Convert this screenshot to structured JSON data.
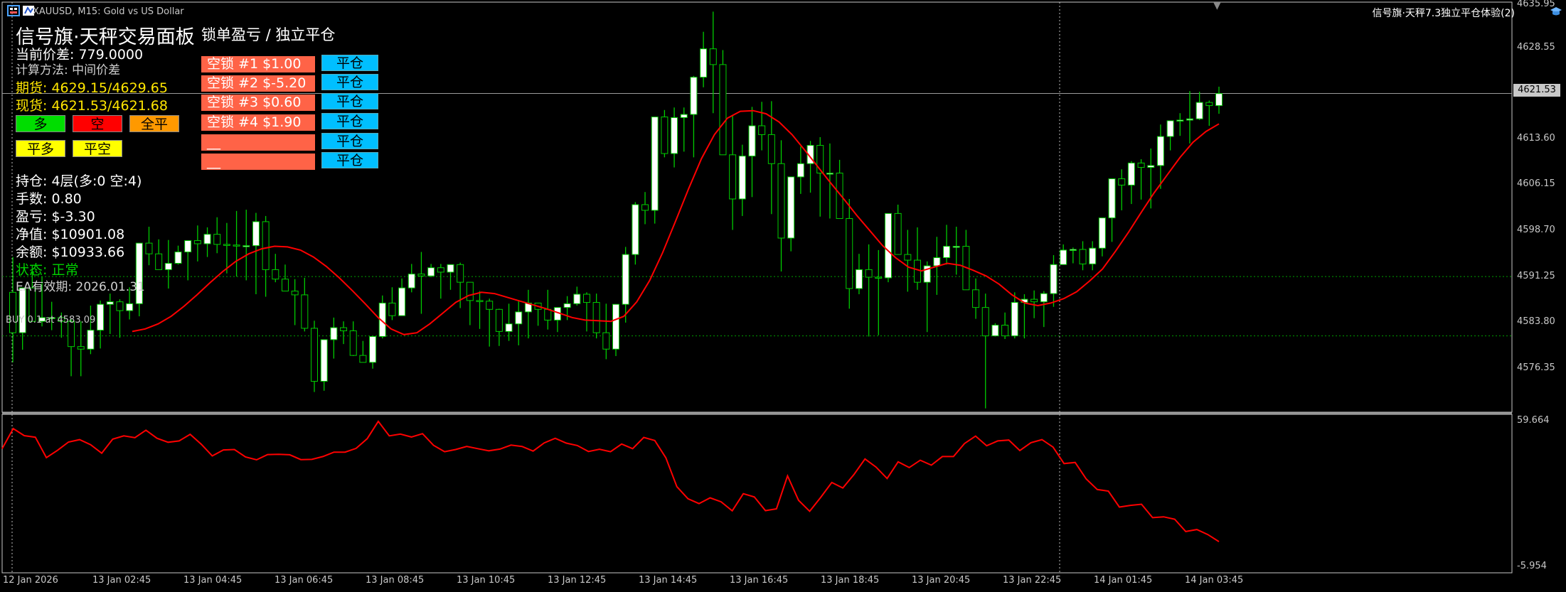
{
  "window": {
    "symbol_title": "XAUUSD, M15:  Gold vs US Dollar",
    "indicator_name": "信号旗·天秤7.3独立平仓体验(2)",
    "icons": [
      "chart-menu-icon",
      "chart-type-icon",
      "hat-icon"
    ]
  },
  "panel": {
    "title": "信号旗·天秤交易面板",
    "current_spread": "当前价差: 779.0000",
    "calc_method": "计算方法: 中间价差",
    "futures": "期货: 4629.15/4629.65",
    "spot": "现货: 4621.53/4621.68",
    "buttons": {
      "buy": "多",
      "sell": "空",
      "close_all": "全平",
      "close_buy": "平多",
      "close_sell": "平空"
    },
    "holdings": "持仓: 4层(多:0 空:4)",
    "lots": "手数: 0.80",
    "profit": "盈亏: $-3.30",
    "equity": "净值: $10901.08",
    "balance": "余额: $10933.66",
    "status": "状态: 正常",
    "expiry": "EA有效期: 2026.01.31"
  },
  "lock_panel": {
    "title": "锁单盈亏 / 独立平仓",
    "rows": [
      {
        "label": "空锁 #1  $1.00",
        "button": "平仓"
      },
      {
        "label": "空锁 #2  $-5.20",
        "button": "平仓"
      },
      {
        "label": "空锁 #3  $0.60",
        "button": "平仓"
      },
      {
        "label": "空锁 #4  $1.90",
        "button": "平仓"
      },
      {
        "label": "__",
        "button": "平仓"
      },
      {
        "label": "__",
        "button": "平仓"
      }
    ]
  },
  "order_label": "BUY 0.1 at 4583.09",
  "price_axis": [
    "4635.95",
    "4628.55",
    "4621.53",
    "4613.60",
    "4606.15",
    "4598.70",
    "4591.25",
    "4583.80",
    "4576.35"
  ],
  "current_price": "4621.53",
  "indicator_axis": [
    "59.664",
    "-5.954"
  ],
  "time_axis": [
    "12 Jan 2026",
    "13 Jan 02:45",
    "13 Jan 04:45",
    "13 Jan 06:45",
    "13 Jan 08:45",
    "13 Jan 10:45",
    "13 Jan 12:45",
    "13 Jan 14:45",
    "13 Jan 16:45",
    "13 Jan 18:45",
    "13 Jan 20:45",
    "13 Jan 22:45",
    "14 Jan 01:45",
    "14 Jan 03:45"
  ],
  "colors": {
    "bull": "#ffffff",
    "bear": "#000000",
    "wick": "#00cc00",
    "ma": "#ff0000",
    "grid_dotted": "#00a000",
    "border": "#c8c8c8"
  },
  "chart_data": {
    "type": "candlestick",
    "price_range": [
      4571.0,
      4636.0
    ],
    "indicator_range": [
      -5.954,
      59.664
    ],
    "candles_ohlc": [
      [
        4590.0,
        4595.6,
        4578.9,
        4583.6
      ],
      [
        4583.6,
        4590.7,
        4580.9,
        4590.7
      ],
      [
        4590.7,
        4594.3,
        4585.4,
        4585.4
      ],
      [
        4585.4,
        4592.5,
        4584.6,
        4586.0
      ],
      [
        4586.0,
        4588.5,
        4584.0,
        4586.0
      ],
      [
        4586.0,
        4586.8,
        4582.8,
        4585.4
      ],
      [
        4585.4,
        4585.8,
        4576.7,
        4581.4
      ],
      [
        4581.4,
        4585.4,
        4576.7,
        4581.0
      ],
      [
        4581.0,
        4587.9,
        4580.2,
        4584.0
      ],
      [
        4584.0,
        4588.7,
        4581.1,
        4588.1
      ],
      [
        4588.1,
        4589.8,
        4583.4,
        4588.5
      ],
      [
        4588.5,
        4588.9,
        4582.8,
        4587.1
      ],
      [
        4587.1,
        4590.8,
        4585.7,
        4588.2
      ],
      [
        4588.2,
        4597.8,
        4586.2,
        4597.8
      ],
      [
        4597.8,
        4600.4,
        4594.3,
        4596.1
      ],
      [
        4596.1,
        4598.4,
        4593.8,
        4593.6
      ],
      [
        4593.6,
        4598.3,
        4590.6,
        4594.6
      ],
      [
        4594.6,
        4597.4,
        4594.4,
        4596.4
      ],
      [
        4596.4,
        4598.2,
        4591.9,
        4598.2
      ],
      [
        4598.2,
        4600.6,
        4594.9,
        4597.7
      ],
      [
        4597.7,
        4600.3,
        4595.6,
        4599.2
      ],
      [
        4599.2,
        4601.9,
        4596.2,
        4597.6
      ],
      [
        4597.6,
        4601.0,
        4593.0,
        4597.5
      ],
      [
        4597.5,
        4602.9,
        4592.5,
        4597.4
      ],
      [
        4597.4,
        4603.1,
        4591.9,
        4597.4
      ],
      [
        4597.4,
        4602.6,
        4589.7,
        4601.2
      ],
      [
        4601.2,
        4602.1,
        4589.3,
        4593.6
      ],
      [
        4593.6,
        4596.1,
        4591.6,
        4592.1
      ],
      [
        4592.1,
        4594.4,
        4590.5,
        4590.2
      ],
      [
        4590.2,
        4592.1,
        4584.8,
        4589.6
      ],
      [
        4589.6,
        4592.3,
        4583.8,
        4584.3
      ],
      [
        4584.3,
        4585.5,
        4574.2,
        4575.9
      ],
      [
        4575.9,
        4579.3,
        4574.4,
        4582.5
      ],
      [
        4582.5,
        4586.0,
        4579.5,
        4584.4
      ],
      [
        4584.4,
        4585.4,
        4581.8,
        4583.9
      ],
      [
        4583.9,
        4585.4,
        4579.9,
        4580.0
      ],
      [
        4580.0,
        4582.3,
        4579.5,
        4578.9
      ],
      [
        4578.9,
        4581.6,
        4577.9,
        4583.0
      ],
      [
        4583.0,
        4589.5,
        4582.7,
        4588.3
      ],
      [
        4588.3,
        4590.8,
        4585.6,
        4586.3
      ],
      [
        4586.3,
        4592.2,
        4586.4,
        4590.7
      ],
      [
        4590.7,
        4594.5,
        4590.0,
        4592.9
      ],
      [
        4592.9,
        4596.4,
        4586.6,
        4592.6
      ],
      [
        4592.6,
        4594.5,
        4592.4,
        4593.9
      ],
      [
        4593.9,
        4594.5,
        4589.0,
        4593.2
      ],
      [
        4593.2,
        4594.4,
        4590.4,
        4594.4
      ],
      [
        4594.4,
        4594.7,
        4587.5,
        4591.6
      ],
      [
        4591.6,
        4591.1,
        4584.8,
        4588.7
      ],
      [
        4588.7,
        4590.2,
        4584.2,
        4588.6
      ],
      [
        4588.6,
        4589.0,
        4581.4,
        4587.3
      ],
      [
        4587.3,
        4587.4,
        4581.5,
        4583.8
      ],
      [
        4583.8,
        4588.2,
        4582.3,
        4585.0
      ],
      [
        4585.0,
        4588.7,
        4581.6,
        4586.9
      ],
      [
        4586.9,
        4590.4,
        4582.7,
        4588.3
      ],
      [
        4588.3,
        4588.2,
        4584.7,
        4587.3
      ],
      [
        4587.3,
        4590.4,
        4584.1,
        4585.6
      ],
      [
        4585.6,
        4587.6,
        4583.7,
        4587.6
      ],
      [
        4587.6,
        4589.4,
        4585.6,
        4588.2
      ],
      [
        4588.2,
        4590.9,
        4587.9,
        4589.7
      ],
      [
        4589.7,
        4590.0,
        4583.8,
        4588.4
      ],
      [
        4588.4,
        4589.8,
        4582.7,
        4583.6
      ],
      [
        4583.6,
        4588.2,
        4579.4,
        4581.0
      ],
      [
        4581.0,
        4588.1,
        4579.9,
        4588.1
      ],
      [
        4588.1,
        4597.2,
        4585.2,
        4596.0
      ],
      [
        4596.0,
        4604.3,
        4594.4,
        4603.9
      ],
      [
        4603.9,
        4605.9,
        4600.8,
        4603.0
      ],
      [
        4603.0,
        4616.8,
        4600.9,
        4617.8
      ],
      [
        4617.8,
        4618.9,
        4611.4,
        4612.0
      ],
      [
        4612.0,
        4619.3,
        4609.8,
        4617.7
      ],
      [
        4617.7,
        4619.3,
        4612.3,
        4618.2
      ],
      [
        4618.2,
        4624.3,
        4611.4,
        4624.1
      ],
      [
        4624.1,
        4631.3,
        4622.5,
        4628.6
      ],
      [
        4628.6,
        4634.5,
        4618.4,
        4626.1
      ],
      [
        4626.1,
        4628.4,
        4615.8,
        4611.8
      ],
      [
        4611.8,
        4618.1,
        4599.9,
        4604.8
      ],
      [
        4604.8,
        4613.4,
        4602.1,
        4611.6
      ],
      [
        4611.6,
        4619.4,
        4605.1,
        4616.4
      ],
      [
        4616.4,
        4620.2,
        4612.5,
        4615.0
      ],
      [
        4615.0,
        4620.3,
        4602.4,
        4610.4
      ],
      [
        4610.4,
        4614.1,
        4593.3,
        4598.6
      ],
      [
        4598.6,
        4604.6,
        4596.5,
        4608.3
      ],
      [
        4608.3,
        4613.1,
        4605.6,
        4610.4
      ],
      [
        4610.4,
        4614.0,
        4605.8,
        4613.3
      ],
      [
        4613.3,
        4614.6,
        4602.0,
        4608.9
      ],
      [
        4608.9,
        4613.6,
        4601.7,
        4608.9
      ],
      [
        4608.9,
        4611.0,
        4604.8,
        4601.7
      ],
      [
        4601.7,
        4604.8,
        4587.4,
        4590.6
      ],
      [
        4590.6,
        4596.1,
        4589.7,
        4593.6
      ],
      [
        4593.6,
        4597.6,
        4583.0,
        4592.4
      ],
      [
        4592.4,
        4596.7,
        4583.2,
        4592.3
      ],
      [
        4592.3,
        4595.7,
        4591.6,
        4602.5
      ],
      [
        4602.5,
        4603.9,
        4599.5,
        4596.0
      ],
      [
        4596.0,
        4599.9,
        4590.1,
        4595.1
      ],
      [
        4595.1,
        4600.3,
        4590.4,
        4591.6
      ],
      [
        4591.6,
        4594.9,
        4583.7,
        4594.2
      ],
      [
        4594.2,
        4598.8,
        4589.6,
        4595.5
      ],
      [
        4595.5,
        4600.7,
        4594.4,
        4597.3
      ],
      [
        4597.3,
        4600.4,
        4592.8,
        4597.3
      ],
      [
        4597.3,
        4599.9,
        4591.4,
        4590.4
      ],
      [
        4590.4,
        4592.2,
        4585.8,
        4587.6
      ],
      [
        4587.6,
        4589.8,
        4571.6,
        4583.1
      ],
      [
        4583.1,
        4585.1,
        4583.0,
        4584.8
      ],
      [
        4584.8,
        4586.8,
        4582.6,
        4583.1
      ],
      [
        4583.1,
        4590.0,
        4582.7,
        4588.4
      ],
      [
        4588.4,
        4589.7,
        4582.7,
        4588.9
      ],
      [
        4588.9,
        4590.3,
        4585.9,
        4588.5
      ],
      [
        4588.5,
        4590.2,
        4584.5,
        4589.8
      ],
      [
        4589.8,
        4595.9,
        4587.7,
        4594.4
      ],
      [
        4594.4,
        4597.6,
        4594.4,
        4596.7
      ],
      [
        4596.7,
        4597.1,
        4594.6,
        4596.8
      ],
      [
        4596.8,
        4598.1,
        4593.5,
        4594.5
      ],
      [
        4594.5,
        4598.1,
        4593.5,
        4597.0
      ],
      [
        4597.0,
        4601.8,
        4595.7,
        4601.8
      ],
      [
        4601.8,
        4607.1,
        4598.0,
        4608.0
      ],
      [
        4608.0,
        4609.5,
        4603.0,
        4607.0
      ],
      [
        4607.0,
        4610.8,
        4604.0,
        4610.5
      ],
      [
        4610.5,
        4611.1,
        4604.7,
        4609.8
      ],
      [
        4609.8,
        4612.8,
        4603.3,
        4610.1
      ],
      [
        4610.1,
        4616.6,
        4606.4,
        4614.7
      ],
      [
        4614.7,
        4616.7,
        4612.5,
        4617.2
      ],
      [
        4617.2,
        4618.4,
        4614.8,
        4617.3
      ],
      [
        4617.3,
        4621.9,
        4613.6,
        4617.5
      ],
      [
        4617.5,
        4621.8,
        4617.3,
        4620.1
      ],
      [
        4620.1,
        4620.4,
        4616.4,
        4619.6
      ],
      [
        4619.6,
        4622.6,
        4618.3,
        4621.5
      ]
    ],
    "ma_line": [
      4583.8,
      4584.2,
      4585.0,
      4586.2,
      4587.8,
      4589.6,
      4591.5,
      4593.3,
      4594.9,
      4596.1,
      4596.9,
      4597.3,
      4597.2,
      4596.7,
      4595.6,
      4594.1,
      4592.3,
      4590.3,
      4588.2,
      4586.0,
      4584.2,
      4583.3,
      4583.6,
      4585.0,
      4586.7,
      4588.4,
      4589.5,
      4590.0,
      4589.8,
      4589.2,
      4588.6,
      4588.0,
      4587.4,
      4586.7,
      4586.0,
      4585.6,
      4585.5,
      4585.4,
      4586.2,
      4588.5,
      4591.9,
      4596.3,
      4601.3,
      4606.4,
      4611.2,
      4615.0,
      4617.6,
      4618.7,
      4618.8,
      4618.3,
      4617.0,
      4615.0,
      4612.5,
      4609.9,
      4607.3,
      4604.8,
      4602.2,
      4599.8,
      4597.4,
      4595.5,
      4594.0,
      4593.4,
      4594.0,
      4594.6,
      4594.3,
      4593.5,
      4592.6,
      4591.3,
      4589.6,
      4588.3,
      4587.9,
      4588.3,
      4589.0,
      4590.1,
      4591.8,
      4593.7,
      4596.5,
      4599.5,
      4602.7,
      4605.8,
      4608.6,
      4611.4,
      4613.8,
      4615.5,
      4616.7
    ],
    "indicator_line": [
      47.3,
      56.4,
      53.2,
      52.5,
      43.2,
      46.5,
      50.3,
      51.4,
      49.1,
      45.2,
      51.6,
      53.1,
      52.3,
      55.7,
      52.0,
      50.2,
      50.8,
      53.8,
      49.3,
      44.0,
      46.7,
      46.9,
      43.5,
      42.2,
      44.6,
      44.7,
      44.5,
      42.3,
      42.4,
      43.7,
      45.7,
      45.7,
      47.4,
      51.8,
      59.7,
      53.1,
      53.9,
      52.6,
      54.1,
      48.8,
      45.9,
      46.9,
      48.3,
      47.3,
      46.3,
      47.1,
      48.9,
      48.3,
      46.2,
      49.9,
      52.0,
      49.8,
      48.7,
      46.0,
      47.0,
      45.9,
      49.4,
      47.3,
      52.4,
      51.0,
      43.1,
      30.0,
      24.5,
      22.3,
      24.9,
      23.1,
      19.0,
      26.8,
      25.3,
      19.1,
      19.9,
      34.9,
      23.8,
      18.8,
      25.1,
      31.9,
      29.4,
      35.5,
      42.6,
      38.9,
      33.7,
      41.3,
      38.7,
      42.0,
      39.8,
      43.7,
      43.7,
      49.6,
      53.0,
      48.6,
      50.8,
      51.2,
      46.4,
      50.0,
      51.4,
      48.0,
      40.5,
      41.0,
      33.5,
      28.7,
      28.0,
      20.7,
      21.5,
      22.0,
      15.9,
      16.3,
      15.2,
      9.6,
      10.5,
      8.2,
      5.0
    ]
  }
}
